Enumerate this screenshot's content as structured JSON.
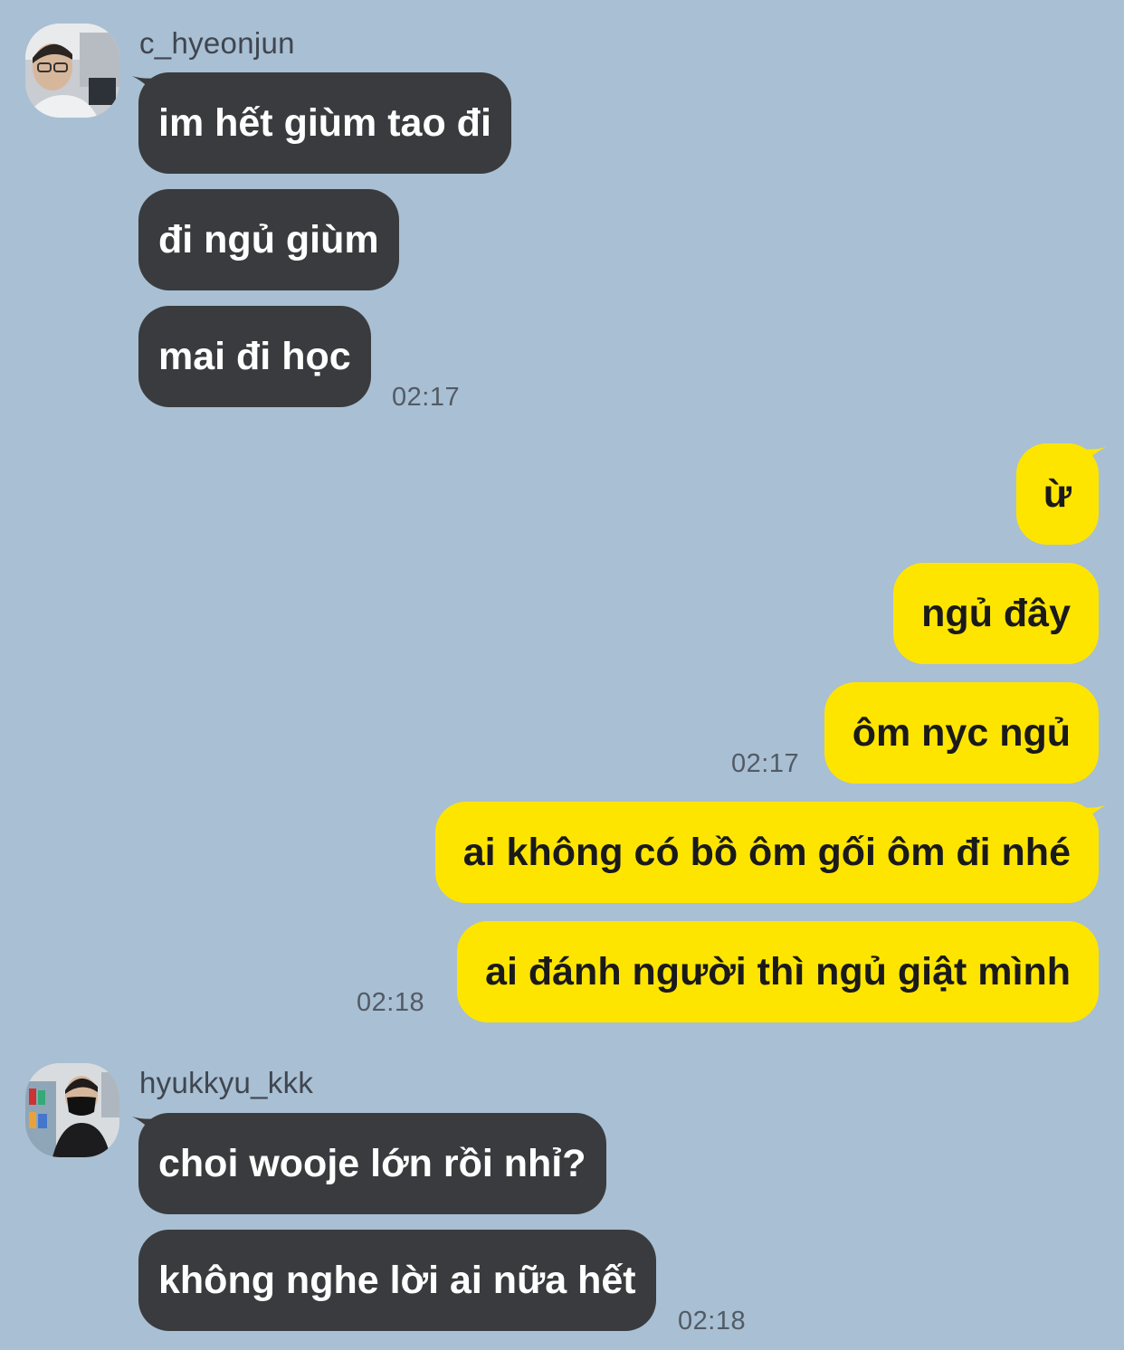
{
  "colors": {
    "background": "#a9bfd3",
    "incoming_bubble": "#3a3b3e",
    "outgoing_bubble": "#fee500",
    "timestamp": "#515b66"
  },
  "chat": {
    "groups": [
      {
        "sender": "c_hyeonjun",
        "avatar_icon": "user-photo-icon",
        "messages": [
          "im hết giùm tao đi",
          "đi ngủ giùm",
          "mai đi học"
        ],
        "time": "02:17"
      },
      {
        "sender": "me",
        "messages": [
          "ừ",
          "ngủ đây",
          "ôm nyc ngủ"
        ],
        "time": "02:17"
      },
      {
        "sender": "me",
        "messages": [
          "ai không có bồ ôm gối ôm đi nhé",
          "ai đánh người thì ngủ giật mình"
        ],
        "time": "02:18"
      },
      {
        "sender": "hyukkyu_kkk",
        "avatar_icon": "user-photo-icon",
        "messages": [
          "choi wooje lớn rồi nhỉ?",
          "không nghe lời ai nữa hết"
        ],
        "time": "02:18"
      }
    ]
  }
}
